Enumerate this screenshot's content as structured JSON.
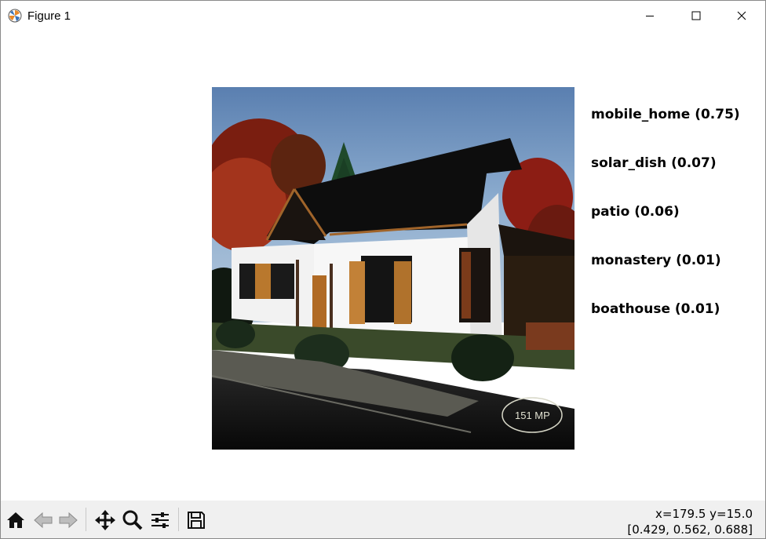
{
  "window": {
    "title": "Figure 1",
    "icon": "matplotlib-icon",
    "controls": [
      "minimize-icon",
      "maximize-icon",
      "close-icon"
    ]
  },
  "image": {
    "description_visible_text": "151 MP"
  },
  "predictions": [
    {
      "label": "mobile_home (0.75)",
      "class": "mobile_home",
      "score": 0.75
    },
    {
      "label": "solar_dish (0.07)",
      "class": "solar_dish",
      "score": 0.07
    },
    {
      "label": "patio (0.06)",
      "class": "patio",
      "score": 0.06
    },
    {
      "label": "monastery (0.01)",
      "class": "monastery",
      "score": 0.01
    },
    {
      "label": "boathouse (0.01)",
      "class": "boathouse",
      "score": 0.01
    }
  ],
  "toolbar": {
    "buttons": [
      "home-icon",
      "back-arrow-icon",
      "forward-arrow-icon",
      "pan-icon",
      "zoom-icon",
      "configure-subplots-icon",
      "save-icon"
    ]
  },
  "status": {
    "coords": "x=179.5 y=15.0",
    "pixel_value": "[0.429, 0.562, 0.688]"
  },
  "colors": {
    "toolbar_bg": "#f0f0f0",
    "window_bg": "#ffffff",
    "text": "#000000"
  }
}
